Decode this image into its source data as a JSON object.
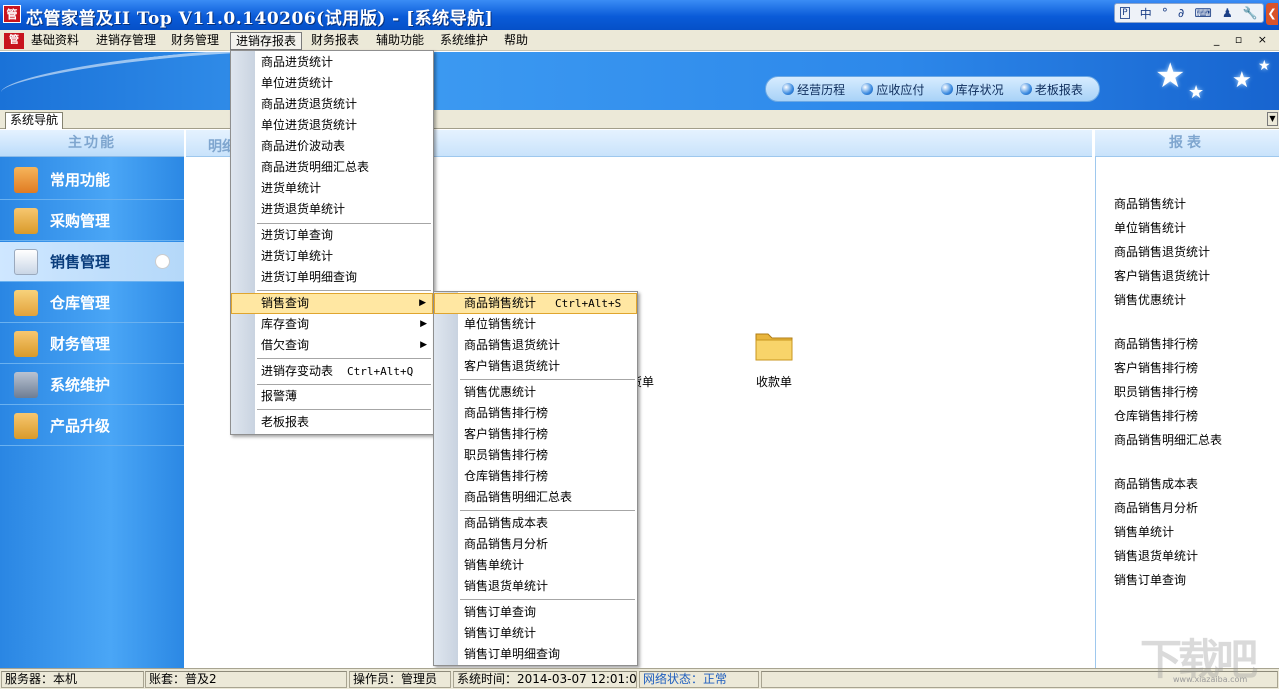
{
  "titlebar": {
    "app_icon": "管",
    "title": "芯管家普及II Top V11.0.140206(试用版) - [系统导航]",
    "ime": [
      "中",
      "°",
      "∂",
      "⌨",
      "♟",
      "🔧"
    ]
  },
  "menubar": {
    "icon": "管",
    "items": [
      "基础资料",
      "进销存管理",
      "财务管理",
      "进销存报表",
      "财务报表",
      "辅助功能",
      "系统维护",
      "帮助"
    ],
    "mdi_controls": "_ ▫ ×"
  },
  "banner": {
    "quick_links": [
      "经营历程",
      "应收应付",
      "库存状况",
      "老板报表"
    ]
  },
  "tabs": {
    "active": "系统导航"
  },
  "sidebar": {
    "header": "主功能",
    "items": [
      {
        "label": "常用功能",
        "icon": "common-functions-icon",
        "color": "#e07b22"
      },
      {
        "label": "采购管理",
        "icon": "purchase-icon",
        "color": "#d99a2a"
      },
      {
        "label": "销售管理",
        "icon": "sales-folder-icon",
        "color": "#f0f0f0"
      },
      {
        "label": "仓库管理",
        "icon": "warehouse-icon",
        "color": "#e3a23b"
      },
      {
        "label": "财务管理",
        "icon": "finance-icon",
        "color": "#d99a2a"
      },
      {
        "label": "系统维护",
        "icon": "maintenance-hammer-icon",
        "color": "#6e7d93"
      },
      {
        "label": "产品升级",
        "icon": "upgrade-icon",
        "color": "#d99a2a"
      }
    ]
  },
  "center": {
    "header": "明细",
    "partial_label": "货单",
    "folder_label": "收款单"
  },
  "right_panel": {
    "header": "报表",
    "groups": [
      [
        "商品销售统计",
        "单位销售统计",
        "商品销售退货统计",
        "客户销售退货统计",
        "销售优惠统计"
      ],
      [
        "商品销售排行榜",
        "客户销售排行榜",
        "职员销售排行榜",
        "仓库销售排行榜",
        "商品销售明细汇总表"
      ],
      [
        "商品销售成本表",
        "商品销售月分析",
        "销售单统计",
        "销售退货单统计",
        "销售订单查询"
      ]
    ]
  },
  "menu_report": {
    "groups": [
      [
        "商品进货统计",
        "单位进货统计",
        "商品进货退货统计",
        "单位进货退货统计",
        "商品进价波动表",
        "商品进货明细汇总表",
        "进货单统计",
        "进货退货单统计"
      ],
      [
        "进货订单查询",
        "进货订单统计",
        "进货订单明细查询"
      ],
      [
        "销售查询",
        "库存查询",
        "借欠查询"
      ],
      [
        "进销存变动表"
      ],
      [
        "报警薄"
      ],
      [
        "老板报表"
      ]
    ],
    "shortcut_change": "Ctrl+Alt+Q"
  },
  "menu_sales": {
    "groups": [
      [
        "商品销售统计",
        "单位销售统计",
        "商品销售退货统计",
        "客户销售退货统计"
      ],
      [
        "销售优惠统计",
        "商品销售排行榜",
        "客户销售排行榜",
        "职员销售排行榜",
        "仓库销售排行榜",
        "商品销售明细汇总表"
      ],
      [
        "商品销售成本表",
        "商品销售月分析",
        "销售单统计",
        "销售退货单统计"
      ],
      [
        "销售订单查询",
        "销售订单统计",
        "销售订单明细查询"
      ]
    ],
    "shortcut": "Ctrl+Alt+S"
  },
  "status": {
    "server": "服务器：本机",
    "account": "账套：普及2",
    "operator": "操作员：管理员",
    "time": "系统时间：2014-03-07 12:01:09",
    "network_label": "网络状态：",
    "network_value": "正常"
  },
  "watermark": {
    "text": "下载吧",
    "url": "www.xiazaiba.com"
  }
}
